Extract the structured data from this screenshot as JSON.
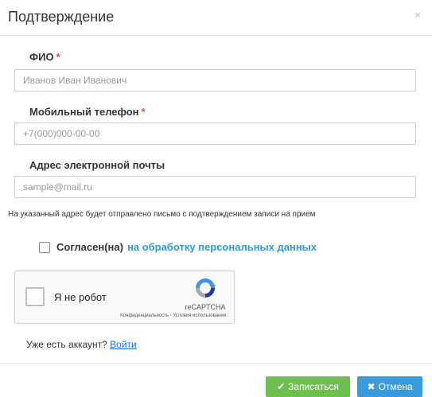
{
  "header": {
    "title": "Подтверждение",
    "close_symbol": "×"
  },
  "form": {
    "fio": {
      "label": "ФИО",
      "required_mark": "*",
      "placeholder": "Иванов Иван Иванович",
      "value": ""
    },
    "phone": {
      "label": "Мобильный телефон",
      "required_mark": "*",
      "placeholder": "+7(000)000-00-00",
      "value": ""
    },
    "email": {
      "label": "Адрес электронной почты",
      "placeholder": "sample@mail.ru",
      "value": ""
    },
    "notice": "На указанный адрес будет отправлено письмо с подтверждением записи на прием",
    "consent": {
      "text": "Согласен(на)",
      "link": "на обработку персональных данных",
      "checked": false
    }
  },
  "recaptcha": {
    "label": "Я не робот",
    "brand": "reCAPTCHA",
    "privacy": "Конфиденциальность",
    "separator": " - ",
    "terms": "Условия использования",
    "checked": false
  },
  "account": {
    "text": "Уже есть аккаунт?",
    "login_link": "Войти"
  },
  "footer": {
    "submit_icon": "✔",
    "submit_label": "Записаться",
    "cancel_icon": "✖",
    "cancel_label": "Отмена"
  },
  "colors": {
    "required": "#e74c3c",
    "consent_link": "#2e9ad8",
    "login_link": "#1a73e8",
    "submit_button": "#6fbf4f",
    "cancel_button": "#3a9bdc"
  },
  "icons": {
    "close": "close-icon",
    "submit": "check-icon",
    "cancel": "times-icon",
    "recaptcha": "recaptcha-logo-icon"
  }
}
